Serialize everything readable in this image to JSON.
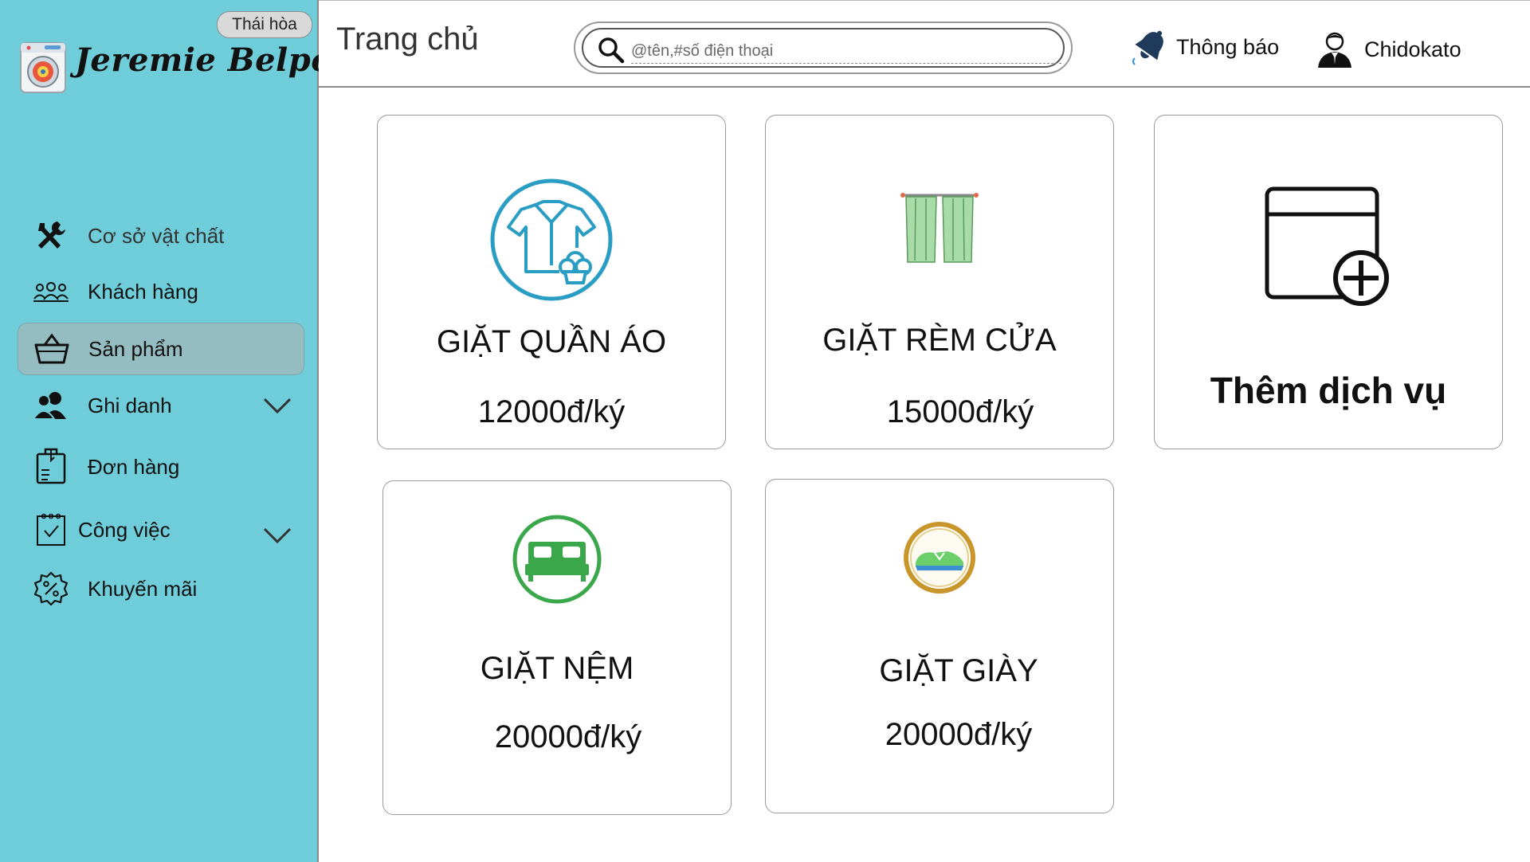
{
  "app": {
    "brand_name": "Jeremie Belpois",
    "branch_badge": "Thái hòa"
  },
  "sidebar": {
    "items": [
      {
        "label": "Cơ sở vật chất",
        "icon": "tools-icon",
        "active": false,
        "has_chevron": false
      },
      {
        "label": "Khách hàng",
        "icon": "customers-icon",
        "active": false,
        "has_chevron": false
      },
      {
        "label": "Sản phẩm",
        "icon": "basket-icon",
        "active": true,
        "has_chevron": false
      },
      {
        "label": "Ghi danh",
        "icon": "users-icon",
        "active": false,
        "has_chevron": true
      },
      {
        "label": "Đơn hàng",
        "icon": "order-icon",
        "active": false,
        "has_chevron": false
      },
      {
        "label": "Công việc",
        "icon": "calendar-check-icon",
        "active": false,
        "has_chevron": true
      },
      {
        "label": "Khuyến mãi",
        "icon": "discount-icon",
        "active": false,
        "has_chevron": false
      }
    ]
  },
  "header": {
    "title": "Trang chủ",
    "search_placeholder": "@tên,#số điện thoại",
    "notification_label": "Thông báo",
    "user_name": "Chidokato"
  },
  "services": [
    {
      "name": "GIẶT QUẦN ÁO",
      "price": "12000đ/ký",
      "icon": "shirt-wash-icon"
    },
    {
      "name": "GIẶT RÈM CỬA",
      "price": "15000đ/ký",
      "icon": "curtain-icon"
    },
    {
      "name": "GIẶT NỆM",
      "price": "20000đ/ký",
      "icon": "bed-icon"
    },
    {
      "name": "GIẶT GIÀY",
      "price": "20000đ/ký",
      "icon": "shoe-icon"
    }
  ],
  "add_service": {
    "label": "Thêm dịch vụ",
    "icon": "add-window-icon"
  },
  "colors": {
    "sidebar_bg": "#6ecdd9",
    "active_item_bg": "#95bcc1",
    "shirt_icon": "#2a9dc4",
    "bed_icon": "#3aa74a",
    "curtain": "#a8dba8"
  }
}
